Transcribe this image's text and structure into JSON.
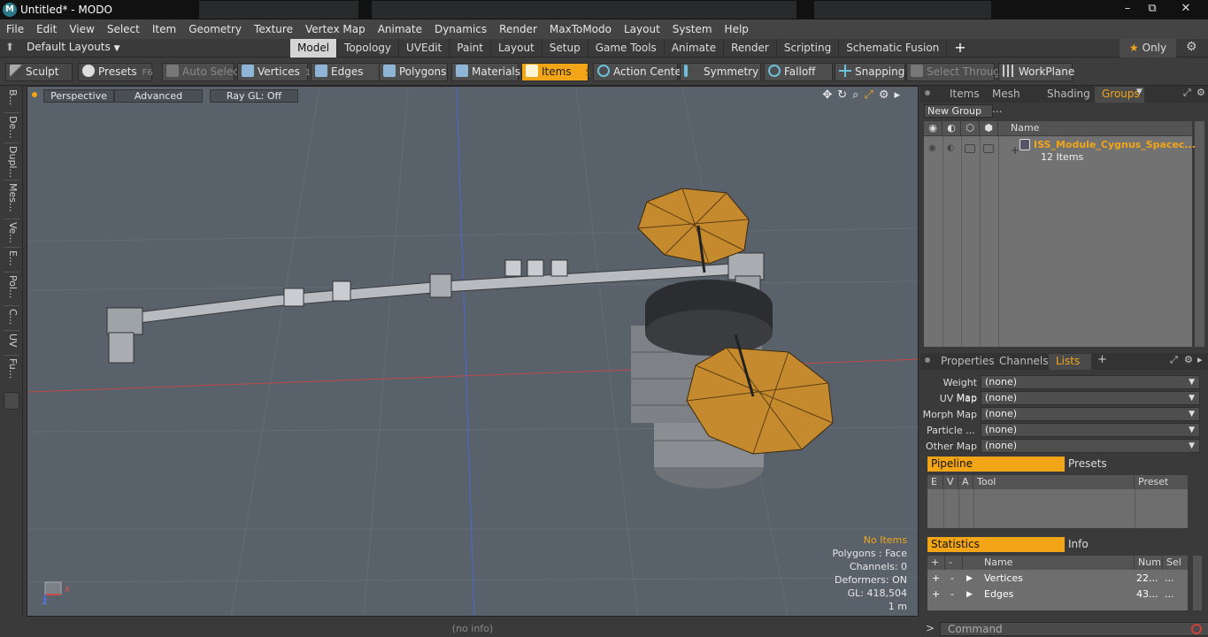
{
  "window": {
    "title": "Untitled* - MODO",
    "app_icon": "modo-logo-icon",
    "controls": [
      "minimize-icon",
      "maximize-icon",
      "close-icon"
    ]
  },
  "menu": [
    "File",
    "Edit",
    "View",
    "Select",
    "Item",
    "Geometry",
    "Texture",
    "Vertex Map",
    "Animate",
    "Dynamics",
    "Render",
    "MaxToModo",
    "Layout",
    "System",
    "Help"
  ],
  "layouts": {
    "selector_label": "Default Layouts",
    "tabs": [
      "Model",
      "Topology",
      "UVEdit",
      "Paint",
      "Layout",
      "Setup",
      "Game Tools",
      "Animate",
      "Render",
      "Scripting",
      "Schematic Fusion"
    ],
    "active_tab": "Model",
    "add_tab": "+",
    "only_label": "Only"
  },
  "toolbar": {
    "sculpt": "Sculpt",
    "presets": "Presets",
    "presets_key": "F6",
    "auto_select": "Auto Select",
    "vertices": "Vertices",
    "vertices_key": "1",
    "edges": "Edges",
    "edges_key": "2",
    "polygons": "Polygons",
    "materials": "Materials",
    "items": "Items",
    "items_key": "5",
    "action_center": "Action Center",
    "symmetry": "Symmetry",
    "falloff": "Falloff",
    "snapping": "Snapping",
    "select_through": "Select Through",
    "workplane": "WorkPlane"
  },
  "left_strip": [
    "B...",
    "De...",
    "Dupl...",
    "Mes...",
    "Ve...",
    "E...",
    "Pol...",
    "C...",
    "UV",
    "Fu..."
  ],
  "viewport": {
    "view_mode": "Perspective",
    "shading": "Advanced",
    "raygl": "Ray GL: Off",
    "nav_icons": [
      "move-icon",
      "rotate-icon",
      "zoom-icon",
      "maximize-view-icon",
      "settings-icon",
      "expand-arrow-icon"
    ],
    "stats": {
      "selection": "No Items",
      "polygons": "Polygons : Face",
      "channels": "Channels: 0",
      "deformers": "Deformers: ON",
      "gl": "GL: 418,504",
      "scale": "1 m"
    },
    "axis_labels": {
      "x": "X",
      "z": "Z"
    }
  },
  "status_bar": "(no info)",
  "command": {
    "prompt": ">",
    "placeholder": "Command"
  },
  "groups_panel": {
    "tabs": [
      "Items",
      "Mesh ...",
      "Shading",
      "Groups"
    ],
    "active_tab": "Groups",
    "new_group": "New Group",
    "columns": {
      "name": "Name"
    },
    "group": {
      "name": "ISS_Module_Cygnus_Spacec...",
      "count": "12 Items",
      "expand": "+"
    }
  },
  "properties_panel": {
    "tabs": [
      "Properties",
      "Channels",
      "Lists"
    ],
    "active_tab": "Lists",
    "add_tab": "+",
    "maps": [
      {
        "label": "Weight Map",
        "value": "(none)"
      },
      {
        "label": "UV Map",
        "value": "(none)"
      },
      {
        "label": "Morph Map",
        "value": "(none)"
      },
      {
        "label": "Particle",
        "value": "(none)",
        "suffix": "..."
      },
      {
        "label": "Other Map",
        "value": "(none)"
      }
    ],
    "pipeline": {
      "tabs": [
        "Pipeline",
        "Presets"
      ],
      "columns": [
        "E",
        "V",
        "A",
        "Tool",
        "Preset"
      ]
    },
    "statistics": {
      "tabs": [
        "Statistics",
        "Info"
      ],
      "columns": [
        "+",
        "-",
        "Name",
        "Num",
        "Sel"
      ],
      "rows": [
        {
          "add": "+",
          "sub": "-",
          "name": "Vertices",
          "num": "22...",
          "sel": "..."
        },
        {
          "add": "+",
          "sub": "-",
          "name": "Edges",
          "num": "43...",
          "sel": "..."
        }
      ]
    }
  },
  "colors": {
    "accent": "#f2a516",
    "viewport_bg": "#59616a",
    "panel_bg": "#3a3a3a"
  }
}
